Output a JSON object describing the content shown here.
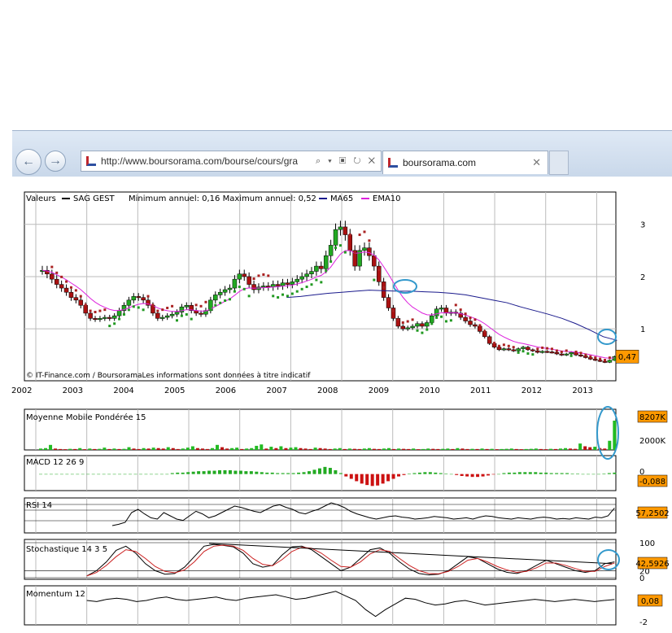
{
  "browser": {
    "back_icon": "back-arrow-icon",
    "forward_icon": "forward-arrow-icon",
    "url": "http://www.boursorama.com/bourse/cours/gra",
    "address_controls": "⌕ ▾ ▣ ↻ ✕",
    "tab_title": "boursorama.com",
    "tab_close": "✕"
  },
  "chart_data": [
    {
      "type": "candlestick",
      "panel": "price",
      "title_parts": [
        "Valeurs",
        "SAG GEST",
        "Minimum annuel: 0,16 Maximum annuel: 0,52",
        "MA65",
        "EMA10"
      ],
      "colors": {
        "up": "#22a822",
        "down": "#aa1111",
        "ma65": "#1a1a8c",
        "ema10": "#dd22dd",
        "sar_red": "#aa2222",
        "sar_green": "#229922"
      },
      "x_ticks": [
        "2002",
        "2003",
        "2004",
        "2005",
        "2006",
        "2007",
        "2008",
        "2009",
        "2010",
        "2011",
        "2012",
        "2013"
      ],
      "x_range": [
        2002.0,
        2013.6
      ],
      "y_ticks": [
        "1",
        "2",
        "3"
      ],
      "y_range": [
        0.1,
        3.4
      ],
      "close": [
        2.12,
        2.05,
        1.95,
        1.85,
        1.78,
        1.7,
        1.6,
        1.55,
        1.45,
        1.3,
        1.2,
        1.18,
        1.2,
        1.22,
        1.2,
        1.25,
        1.35,
        1.45,
        1.55,
        1.62,
        1.6,
        1.55,
        1.45,
        1.3,
        1.2,
        1.22,
        1.25,
        1.28,
        1.32,
        1.42,
        1.45,
        1.35,
        1.3,
        1.28,
        1.35,
        1.55,
        1.65,
        1.7,
        1.75,
        1.78,
        1.95,
        2.05,
        2.0,
        1.85,
        1.75,
        1.8,
        1.82,
        1.8,
        1.85,
        1.82,
        1.88,
        1.85,
        1.9,
        1.95,
        2.0,
        2.05,
        2.1,
        2.2,
        2.15,
        2.4,
        2.6,
        2.9,
        2.95,
        2.8,
        2.5,
        2.2,
        2.5,
        2.55,
        2.4,
        2.2,
        1.9,
        1.6,
        1.4,
        1.2,
        1.05,
        1.0,
        1.02,
        1.05,
        1.1,
        1.05,
        1.12,
        1.25,
        1.38,
        1.4,
        1.3,
        1.32,
        1.3,
        1.22,
        1.15,
        1.08,
        1.05,
        0.95,
        0.85,
        0.72,
        0.65,
        0.6,
        0.62,
        0.6,
        0.58,
        0.62,
        0.65,
        0.6,
        0.58,
        0.55,
        0.57,
        0.56,
        0.55,
        0.52,
        0.5,
        0.52,
        0.55,
        0.5,
        0.48,
        0.45,
        0.42,
        0.4,
        0.38,
        0.36,
        0.4,
        0.47
      ],
      "ma65_start": 2007.0,
      "ma65": [
        1.6,
        1.62,
        1.65,
        1.68,
        1.7,
        1.72,
        1.74,
        1.73,
        1.72,
        1.72,
        1.71,
        1.7,
        1.68,
        1.65,
        1.6,
        1.55,
        1.5,
        1.42,
        1.35,
        1.28,
        1.2,
        1.1,
        0.98,
        0.85,
        0.78
      ],
      "last_label": "0,47",
      "footer": "© IT-Finance.com / BoursoramaLes informations sont données à titre indicatif"
    },
    {
      "type": "bar",
      "panel": "volume",
      "title": "Moyenne Mobile Pondérée 15",
      "y_ticks": [
        "2000K"
      ],
      "last_label": "8207K",
      "values": [
        15,
        20,
        55,
        15,
        10,
        8,
        12,
        10,
        20,
        8,
        15,
        10,
        12,
        25,
        10,
        15,
        10,
        12,
        30,
        15,
        10,
        20,
        15,
        25,
        20,
        15,
        30,
        20,
        10,
        15,
        25,
        40,
        20,
        15,
        10,
        20,
        55,
        30,
        15,
        20,
        25,
        10,
        15,
        20,
        45,
        60,
        15,
        35,
        20,
        40,
        20,
        25,
        30,
        20,
        15,
        10,
        25,
        20,
        15,
        10,
        15,
        20,
        10,
        15,
        12,
        10,
        15,
        20,
        12,
        10,
        15,
        20,
        10,
        15,
        12,
        10,
        15,
        8,
        10,
        15,
        12,
        10,
        12,
        15,
        10,
        20,
        15,
        10,
        12,
        10,
        15,
        10,
        12,
        8,
        10,
        12,
        15,
        10,
        8,
        10,
        12,
        15,
        10,
        8,
        12,
        10,
        15,
        20,
        15,
        12,
        70,
        40,
        30,
        35,
        20,
        15,
        100,
        320
      ]
    },
    {
      "type": "bar",
      "panel": "macd",
      "title": "MACD 12 26 9",
      "y_ticks": [
        "0"
      ],
      "last_label": "-0,088",
      "values": [
        0,
        0,
        0,
        0,
        0,
        0,
        0,
        0,
        0,
        0,
        0,
        0,
        0,
        0,
        0,
        0,
        0,
        0,
        0,
        0,
        0,
        0,
        0,
        0,
        0,
        0.02,
        0.03,
        0.03,
        0.04,
        0.05,
        0.06,
        0.06,
        0.07,
        0.07,
        0.08,
        0.08,
        0.08,
        0.07,
        0.07,
        0.06,
        0.06,
        0.05,
        0.04,
        0.03,
        0.03,
        0.02,
        0.02,
        0.02,
        0.02,
        0.03,
        0.04,
        0.06,
        0.09,
        0.12,
        0.15,
        0.13,
        0.08,
        0.02,
        -0.05,
        -0.1,
        -0.15,
        -0.2,
        -0.23,
        -0.25,
        -0.24,
        -0.2,
        -0.15,
        -0.1,
        -0.05,
        -0.02,
        0.01,
        0.02,
        0.03,
        0.04,
        0.04,
        0.03,
        0.02,
        0.01,
        0.0,
        -0.02,
        -0.04,
        -0.05,
        -0.06,
        -0.06,
        -0.05,
        -0.03,
        -0.01,
        0.0,
        0.02,
        0.03,
        0.03,
        0.04,
        0.04,
        0.04,
        0.04,
        0.03,
        0.03,
        0.02,
        0.02,
        0.02,
        0.02,
        0.01,
        0.01,
        0.0,
        0.0,
        0.0,
        0.0,
        0.01,
        0.02,
        0.03
      ]
    },
    {
      "type": "line",
      "panel": "rsi",
      "title": "RSI 14",
      "y_ticks": [],
      "last_label": "57,2502",
      "values": [
        30,
        32,
        35,
        50,
        55,
        48,
        42,
        40,
        50,
        45,
        40,
        38,
        45,
        52,
        48,
        42,
        45,
        50,
        55,
        60,
        58,
        55,
        52,
        50,
        55,
        60,
        62,
        58,
        55,
        50,
        48,
        52,
        55,
        60,
        65,
        62,
        58,
        52,
        48,
        45,
        42,
        40,
        42,
        44,
        45,
        43,
        42,
        40,
        41,
        42,
        44,
        43,
        42,
        40,
        41,
        42,
        40,
        43,
        45,
        44,
        42,
        41,
        40,
        42,
        41,
        40,
        42,
        43,
        42,
        40,
        41,
        40,
        42,
        41,
        40,
        43,
        42,
        45,
        57
      ]
    },
    {
      "type": "line",
      "panel": "stochastic",
      "title": "Stochastique 14 3 5",
      "y_ticks": [
        "100",
        "20",
        "0"
      ],
      "last_label": "42,5926",
      "values": [
        5,
        20,
        45,
        78,
        90,
        70,
        40,
        20,
        10,
        12,
        30,
        60,
        90,
        95,
        92,
        88,
        70,
        40,
        30,
        35,
        65,
        88,
        90,
        80,
        60,
        40,
        20,
        30,
        55,
        80,
        85,
        70,
        45,
        25,
        12,
        8,
        10,
        20,
        40,
        60,
        55,
        40,
        25,
        15,
        12,
        20,
        35,
        50,
        40,
        30,
        20,
        15,
        20,
        40,
        45
      ],
      "values_smooth": [
        5,
        15,
        35,
        60,
        80,
        75,
        55,
        32,
        18,
        14,
        22,
        45,
        75,
        90,
        93,
        90,
        78,
        55,
        38,
        34,
        52,
        75,
        87,
        84,
        70,
        50,
        32,
        30,
        45,
        68,
        80,
        75,
        55,
        35,
        20,
        12,
        11,
        18,
        32,
        50,
        55,
        45,
        32,
        22,
        15,
        18,
        28,
        42,
        42,
        35,
        26,
        18,
        18,
        32,
        42
      ],
      "trend_line": [
        [
          2005.4,
          98
        ],
        [
          2013.3,
          40
        ]
      ]
    },
    {
      "type": "line",
      "panel": "momentum",
      "title": "Momentum 12",
      "y_ticks": [
        "-2"
      ],
      "last_label": "0,08",
      "values": [
        0,
        -0.1,
        0.1,
        0.2,
        0.1,
        -0.1,
        0,
        0.2,
        0.3,
        0.1,
        0,
        0.1,
        0.2,
        0.3,
        0.1,
        0,
        0.2,
        0.3,
        0.4,
        0.5,
        0.3,
        0.1,
        0.2,
        0.4,
        0.6,
        0.8,
        0.4,
        0,
        -0.8,
        -1.4,
        -0.8,
        -0.3,
        0.2,
        0.1,
        -0.2,
        -0.4,
        -0.3,
        -0.1,
        0,
        -0.2,
        -0.4,
        -0.3,
        -0.2,
        -0.1,
        0,
        0.1,
        0,
        -0.1,
        0,
        0.1,
        0,
        -0.1,
        0,
        0.08
      ]
    }
  ]
}
